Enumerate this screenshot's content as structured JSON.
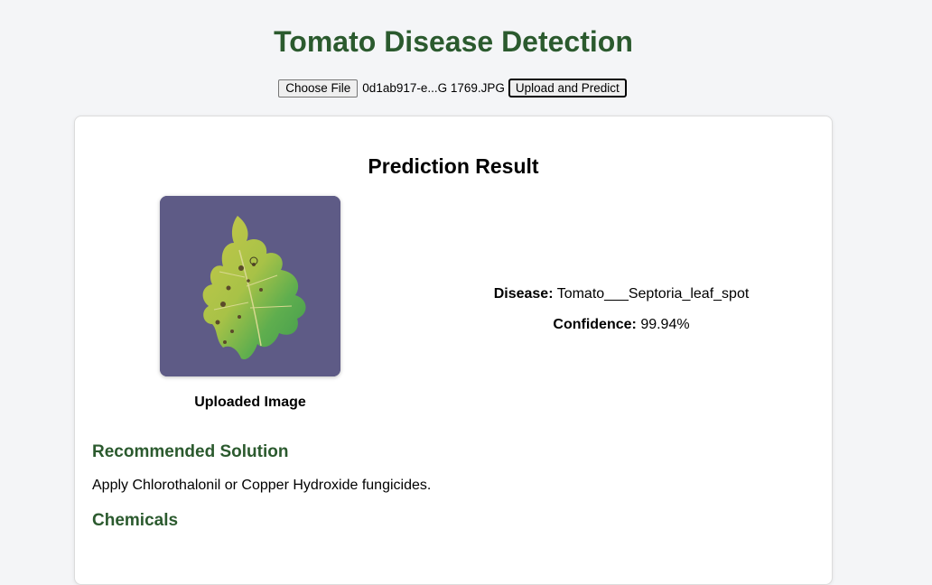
{
  "header": {
    "title": "Tomato Disease Detection"
  },
  "upload": {
    "choose_label": "Choose File",
    "file_name": "0d1ab917-e...G 1769.JPG",
    "submit_label": "Upload and Predict"
  },
  "result": {
    "heading": "Prediction Result",
    "image_caption": "Uploaded Image",
    "disease_label": "Disease:",
    "disease_value": "Tomato___Septoria_leaf_spot",
    "confidence_label": "Confidence:",
    "confidence_value": "99.94%"
  },
  "solution": {
    "heading": "Recommended Solution",
    "text": "Apply Chlorothalonil or Copper Hydroxide fungicides."
  },
  "chemicals": {
    "heading": "Chemicals"
  },
  "colors": {
    "accent_green": "#2b5a2e",
    "image_background": "#5e5b86",
    "page_background": "#f4f5f7"
  }
}
